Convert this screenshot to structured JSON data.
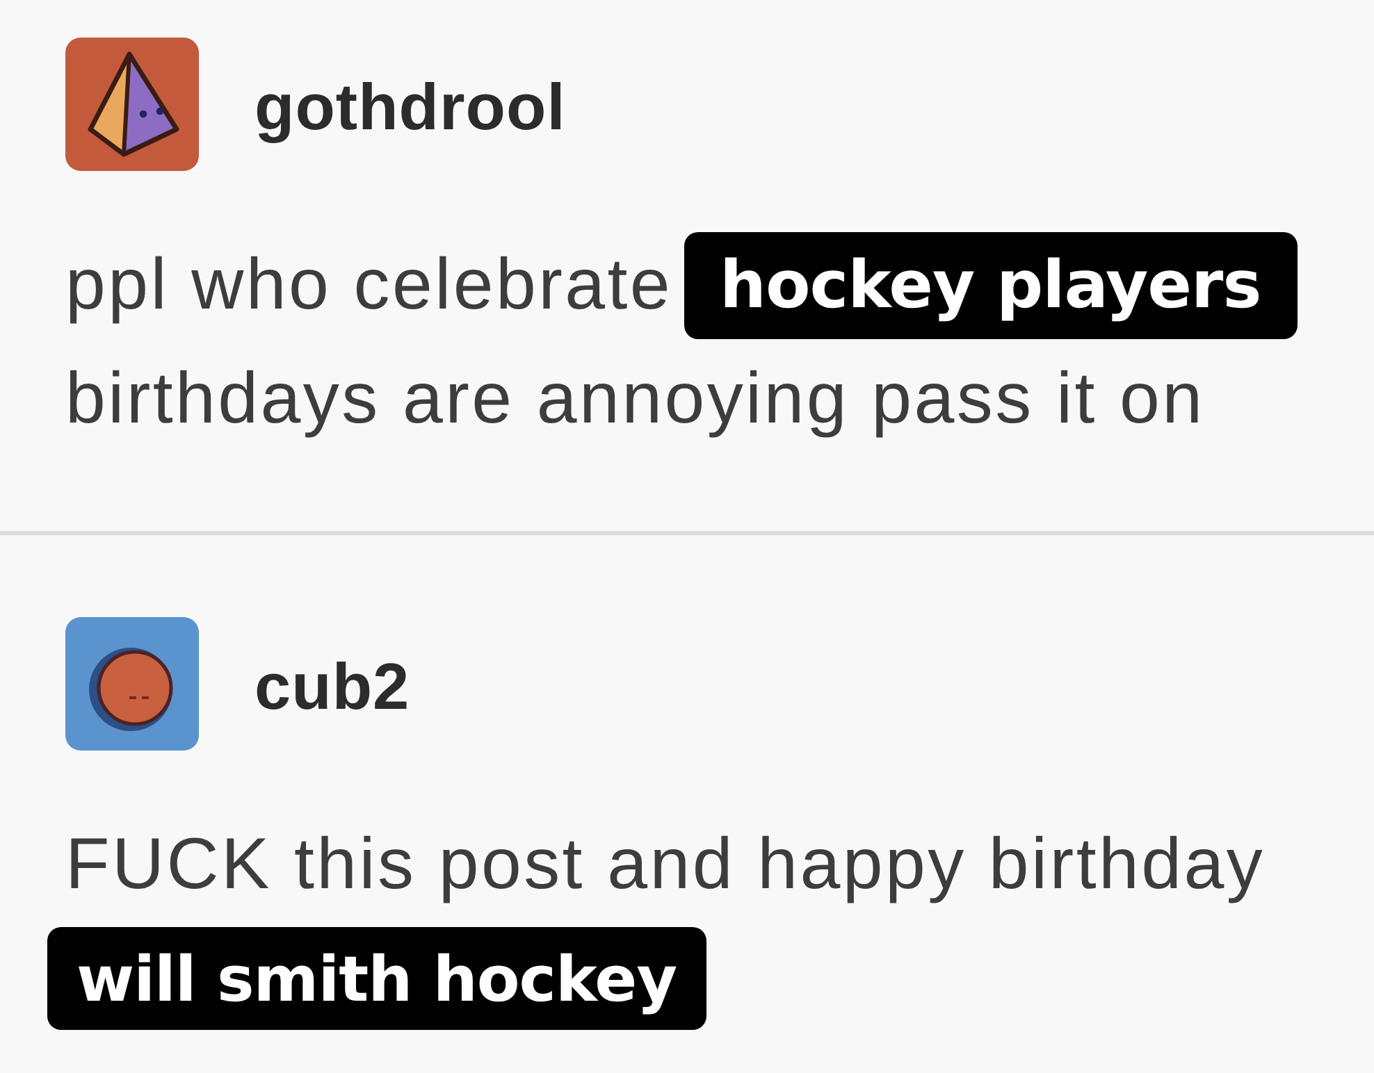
{
  "posts": [
    {
      "avatar": {
        "kind": "pyramid"
      },
      "username": "gothdrool",
      "lines": [
        [
          {
            "kind": "text",
            "text": "ppl who celebrate"
          },
          {
            "kind": "highlight",
            "text": "hockey players"
          }
        ],
        [
          {
            "kind": "text",
            "text": "birthdays are annoying pass it on"
          }
        ]
      ]
    },
    {
      "avatar": {
        "kind": "ball"
      },
      "username": "cub2",
      "lines": [
        [
          {
            "kind": "text",
            "text": "FUCK this post and happy birthday"
          }
        ],
        [
          {
            "kind": "highlight",
            "text": "will smith hockey"
          }
        ]
      ]
    }
  ]
}
